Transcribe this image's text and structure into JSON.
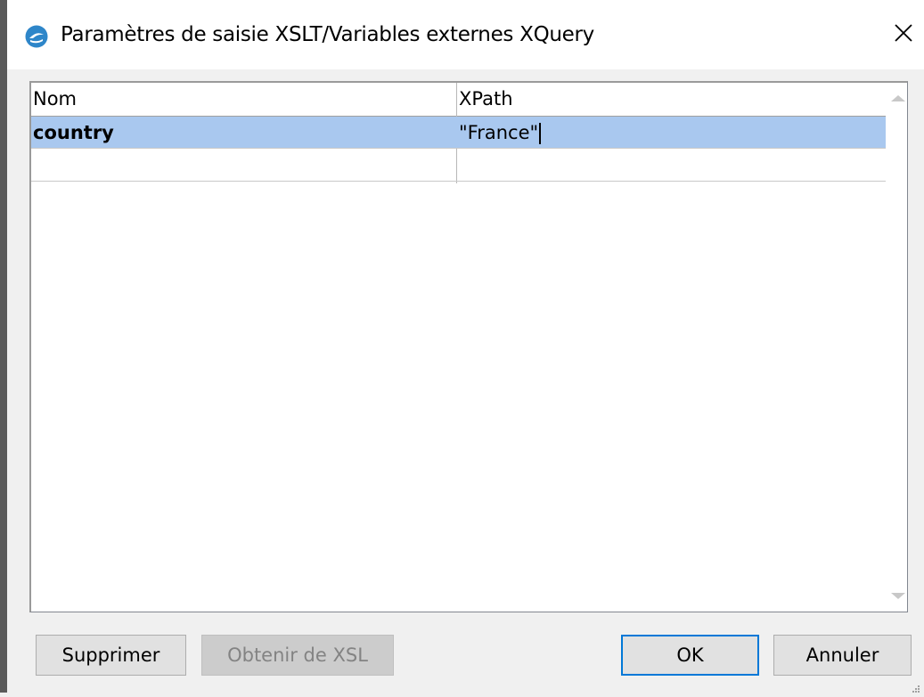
{
  "window": {
    "title": "Paramètres de saisie XSLT/Variables externes XQuery",
    "accent_color": "#0078d7",
    "icon": "altova-app-icon"
  },
  "grid": {
    "columns": [
      "Nom",
      "XPath"
    ],
    "rows": [
      {
        "name": "country",
        "xpath": "\"France\"",
        "selected": true,
        "editing": true
      },
      {
        "name": "",
        "xpath": "",
        "selected": false
      }
    ],
    "selection_color": "#a9c8ef"
  },
  "buttons": {
    "delete": "Supprimer",
    "get_from_xsl": "Obtenir de XSL",
    "ok": "OK",
    "cancel": "Annuler"
  }
}
